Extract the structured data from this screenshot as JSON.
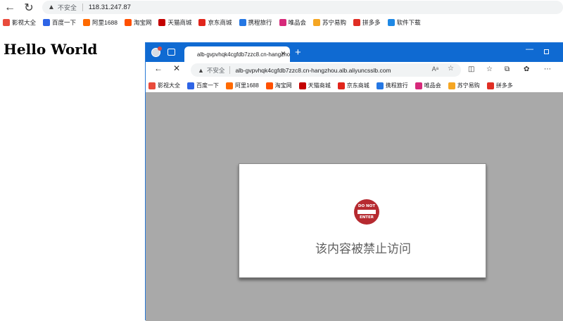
{
  "outer": {
    "address": {
      "insecure_label": "不安全",
      "url": "118.31.247.87"
    },
    "bookmarks": [
      {
        "label": "影视大全",
        "color": "#e94b3c"
      },
      {
        "label": "百度一下",
        "color": "#2e64e6"
      },
      {
        "label": "阿里1688",
        "color": "#ff6a00"
      },
      {
        "label": "淘宝网",
        "color": "#ff5000"
      },
      {
        "label": "天猫商城",
        "color": "#c40000"
      },
      {
        "label": "京东商城",
        "color": "#e1251b"
      },
      {
        "label": "携程旅行",
        "color": "#2577e3"
      },
      {
        "label": "唯品会",
        "color": "#d6297a"
      },
      {
        "label": "苏宁易购",
        "color": "#f5a623"
      },
      {
        "label": "拼多多",
        "color": "#e02e24"
      },
      {
        "label": "软件下载",
        "color": "#1e88e5"
      }
    ]
  },
  "page": {
    "heading": "Hello World"
  },
  "inner": {
    "tab_title": "alb-gvpvhqk4cgfdb7zzc8.cn-hangzhou",
    "address": {
      "insecure_label": "不安全",
      "url": "alb-gvpvhqk4cgfdb7zzc8.cn-hangzhou.alb.aliyuncsslb.com"
    },
    "bookmarks": [
      {
        "label": "影视大全",
        "color": "#e94b3c"
      },
      {
        "label": "百度一下",
        "color": "#2e64e6"
      },
      {
        "label": "阿里1688",
        "color": "#ff6a00"
      },
      {
        "label": "淘宝网",
        "color": "#ff5000"
      },
      {
        "label": "天猫商城",
        "color": "#c40000"
      },
      {
        "label": "京东商城",
        "color": "#e1251b"
      },
      {
        "label": "携程旅行",
        "color": "#2577e3"
      },
      {
        "label": "唯品会",
        "color": "#d6297a"
      },
      {
        "label": "苏宁易购",
        "color": "#f5a623"
      },
      {
        "label": "拼多多",
        "color": "#e02e24"
      }
    ],
    "sign": {
      "top": "DO NOT",
      "bottom": "ENTER"
    },
    "message": "该内容被禁止访问"
  },
  "colors": {
    "accent": "#0f6ad2",
    "sign": "#b62a30",
    "page_bg": "#a9a9a9"
  }
}
